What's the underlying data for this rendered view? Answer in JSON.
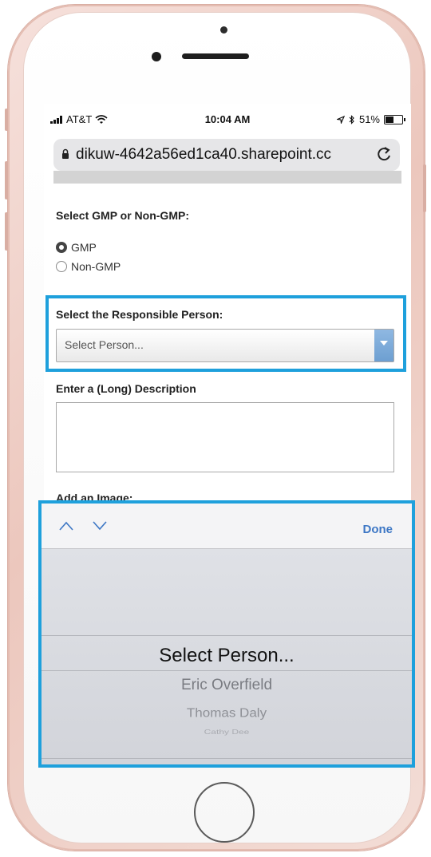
{
  "status_bar": {
    "carrier": "AT&T",
    "time": "10:04 AM",
    "battery": "51%",
    "battery_level": 0.51
  },
  "browser": {
    "url": "dikuw-4642a56ed1ca40.sharepoint.cc",
    "icons": [
      "lock-icon",
      "reload-icon"
    ]
  },
  "form": {
    "gmp_label": "Select GMP or Non-GMP:",
    "options": [
      {
        "label": "GMP",
        "checked": true
      },
      {
        "label": "Non-GMP",
        "checked": false
      }
    ],
    "responsible_label": "Select the Responsible Person:",
    "responsible_value": "Select Person...",
    "description_label": "Enter a (Long) Description",
    "description_value": "",
    "image_label": "Add an Image:"
  },
  "picker": {
    "done_label": "Done",
    "selected": "Select Person...",
    "items": [
      "Eric Overfield",
      "Thomas Daly",
      "Cathy Dee"
    ]
  },
  "colors": {
    "highlight": "#1ea0dc",
    "done_link": "#3d77c5",
    "phone_rose_gold": "#ecc7bd"
  }
}
